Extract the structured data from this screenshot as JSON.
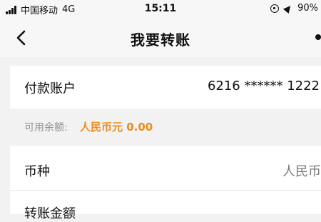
{
  "status_bar": {
    "carrier": "中国移动",
    "network": "4G",
    "time": "15:11",
    "battery": "90%"
  },
  "nav": {
    "title": "我要转账"
  },
  "payment_account": {
    "label": "付款账户",
    "value": "6216 ****** 1222"
  },
  "balance": {
    "label": "可用余额:",
    "amount": "人民币元 0.00"
  },
  "currency": {
    "label": "币种",
    "value": "人民币"
  },
  "transfer_amount": {
    "label": "转账金额"
  },
  "colors": {
    "accent": "#ee8b19",
    "background": "#f2f2f2"
  },
  "icons": [
    "signal-icon",
    "rotation-lock-icon",
    "location-icon",
    "back-arrow-icon",
    "more-dot-icon"
  ]
}
